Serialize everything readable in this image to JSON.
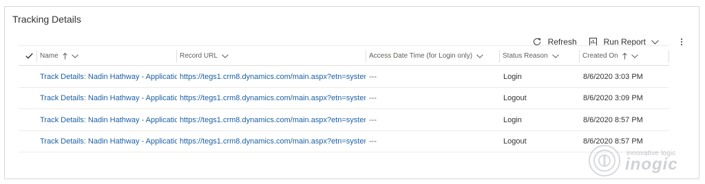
{
  "panel": {
    "title": "Tracking Details"
  },
  "toolbar": {
    "refresh_label": "Refresh",
    "run_report_label": "Run Report",
    "icons": [
      "refresh-icon",
      "report-icon",
      "chevron-down-icon",
      "more-icon"
    ]
  },
  "grid": {
    "columns": [
      {
        "label": "Name",
        "sort": "ascending"
      },
      {
        "label": "Record URL",
        "sort": ""
      },
      {
        "label": "Access Date Time (for Login only)",
        "sort": ""
      },
      {
        "label": "Status Reason",
        "sort": ""
      },
      {
        "label": "Created On",
        "sort": "ascending"
      }
    ],
    "rows": [
      {
        "name": "Track Details: Nadin Hathway - Applicatic",
        "url": "https://tegs1.crm8.dynamics.com/main.aspx?etn=syster",
        "access": "---",
        "status": "Login",
        "created": "8/6/2020 3:03 PM"
      },
      {
        "name": "Track Details: Nadin Hathway - Applicatic",
        "url": "https://tegs1.crm8.dynamics.com/main.aspx?etn=syster",
        "access": "---",
        "status": "Logout",
        "created": "8/6/2020 3:09 PM"
      },
      {
        "name": "Track Details: Nadin Hathway - Applicatic",
        "url": "https://tegs1.crm8.dynamics.com/main.aspx?etn=syster",
        "access": "---",
        "status": "Login",
        "created": "8/6/2020 8:57 PM"
      },
      {
        "name": "Track Details: Nadin Hathway - Applicatic",
        "url": "https://tegs1.crm8.dynamics.com/main.aspx?etn=syster",
        "access": "---",
        "status": "Logout",
        "created": "8/6/2020 8:57 PM"
      }
    ]
  },
  "watermark": {
    "tagline": "innovative logic",
    "brand": "inogic"
  }
}
